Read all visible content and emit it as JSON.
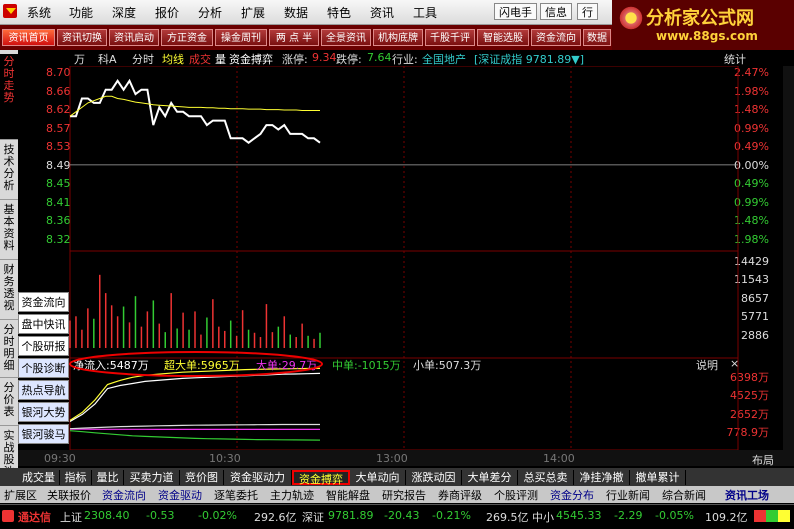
{
  "menu": {
    "items": [
      "系统",
      "功能",
      "深度",
      "报价",
      "分析",
      "扩展",
      "数据",
      "特色",
      "资讯",
      "工具"
    ],
    "right_buttons": [
      "闪电手",
      "信息",
      "行"
    ]
  },
  "logo": {
    "title": "分析家公式网",
    "url": "www.88gs.com"
  },
  "toolbar": {
    "buttons": [
      "资讯首页",
      "资讯切换",
      "资讯启动",
      "方正资金",
      "操金周刊",
      "两 点 半",
      "全景资讯",
      "机构底牌",
      "千股千评",
      "智能选股",
      "资金流向",
      "数据"
    ],
    "active": 0
  },
  "leftbar": {
    "items": [
      "分时走势",
      "技术分析",
      "基本资料",
      "财务透视",
      "分时明细",
      "分价表",
      "实战股池"
    ],
    "active": 0
  },
  "float_panel": [
    "资金流向",
    "盘中快讯",
    "个股研报",
    "个股诊断",
    "热点导航",
    "银河大势",
    "银河骏马"
  ],
  "header": {
    "wan": "万",
    "ke": "科A",
    "fenshi": "分时",
    "junxian": "均线",
    "chengjiao_a": "成交",
    "chengjiao_b": "量",
    "zjby": "资金搏弈",
    "zhangting_label": "涨停:",
    "zhangting": "9.34",
    "dieting_label": "跌停:",
    "dieting": "7.64",
    "hangye_label": "行业:",
    "hangye": "全国地产",
    "index": "[深证成指 9781.89▼]",
    "tongji": "统计"
  },
  "price_axis": {
    "left": [
      "8.70",
      "8.66",
      "8.62",
      "8.57",
      "8.53",
      "8.49",
      "8.45",
      "8.41",
      "8.36",
      "8.32"
    ],
    "right": [
      "2.47%",
      "1.98%",
      "1.48%",
      "0.99%",
      "0.49%",
      "0.00%",
      "0.49%",
      "0.99%",
      "1.48%",
      "1.98%"
    ]
  },
  "volume_axis": {
    "right": [
      "14429",
      "11543",
      "8657",
      "5771",
      "2886"
    ]
  },
  "flow_bar": {
    "net": "净流入:5487万",
    "super": "超大单:5965万",
    "big": "大单:29.7万",
    "mid": "中单:-1015万",
    "small": "小单:507.3万",
    "explain": "说明",
    "close": "×"
  },
  "flow_axis": {
    "right": [
      "6398万",
      "4525万",
      "2652万",
      "778.9万"
    ]
  },
  "time_axis": {
    "labels": [
      "09:30",
      "10:30",
      "13:00",
      "14:00"
    ],
    "layout": "布局"
  },
  "tabs": {
    "items": [
      "成交量",
      "指标",
      "量比",
      "买卖力道",
      "竞价图",
      "资金驱动力",
      "资金搏弈",
      "大单动向",
      "涨跌动因",
      "大单差分",
      "总买总卖",
      "净挂净撤",
      "撤单累计"
    ],
    "active": 6
  },
  "tabs2": {
    "items": [
      "扩展区",
      "关联报价",
      "资金流向",
      "资金驱动",
      "逐笔委托",
      "主力轨迹",
      "智能解盘",
      "研究报告",
      "券商评级",
      "个股评测",
      "资金分布",
      "行业新闻",
      "综合新闻"
    ],
    "selected": [
      2,
      3,
      10
    ],
    "right": "资讯工场"
  },
  "status": {
    "brand": "通达信",
    "sh_label": "上证",
    "sh": "2308.40",
    "sh_chg": "-0.53",
    "sh_pct": "-0.02%",
    "sh_amt": "292.6亿",
    "sz_label": "深证",
    "sz": "9781.89",
    "sz_chg": "-20.43",
    "sz_pct": "-0.21%",
    "sz_amt": "269.5亿",
    "zx_label": "中小",
    "zx": "4545.33",
    "zx_chg": "-2.29",
    "zx_pct": "-0.05%",
    "zx_amt": "109.2亿"
  },
  "chart_data": {
    "type": "line",
    "x_ticks": [
      "09:30",
      "10:30",
      "13:00",
      "14:00"
    ],
    "price": [
      8.6,
      8.6,
      8.64,
      8.64,
      8.63,
      8.63,
      8.66,
      8.66,
      8.68,
      8.66,
      8.68,
      8.65,
      8.66,
      8.66,
      8.58,
      8.62,
      8.6,
      8.63,
      8.61,
      8.61,
      8.6,
      8.6,
      8.6,
      8.58,
      8.59,
      8.59,
      8.59,
      8.55,
      8.55,
      8.55,
      8.54,
      8.55,
      8.56,
      8.58,
      8.58,
      8.57,
      8.58,
      8.56,
      8.56,
      8.56,
      8.55,
      8.55,
      8.54
    ],
    "avg": [
      8.6,
      8.61,
      8.62,
      8.63,
      8.635,
      8.64,
      8.645,
      8.645,
      8.64,
      8.638,
      8.635,
      8.632,
      8.63,
      8.628,
      8.626,
      8.625,
      8.624,
      8.623,
      8.622,
      8.621,
      8.62,
      8.62,
      8.62,
      8.619,
      8.619,
      8.618,
      8.618,
      8.617,
      8.617,
      8.617,
      8.616,
      8.616,
      8.616,
      8.615,
      8.615,
      8.615,
      8.614,
      8.614,
      8.614,
      8.613,
      8.613,
      8.613,
      8.613
    ],
    "ylim": [
      8.32,
      8.7
    ],
    "volume": [
      4500,
      5200,
      3000,
      6500,
      4800,
      12000,
      9000,
      7000,
      5200,
      6800,
      4200,
      8500,
      3500,
      6000,
      7800,
      4000,
      2600,
      9000,
      3200,
      5800,
      3000,
      6000,
      2200,
      5000,
      8000,
      3500,
      2800,
      4500,
      2000,
      6200,
      3000,
      2500,
      1800,
      7200,
      2600,
      3500,
      5200,
      2200,
      1800,
      4000,
      2000,
      1500,
      2500
    ],
    "volume_ylim": [
      0,
      14429
    ],
    "flow": {
      "net": [
        800,
        1500,
        2500,
        4000,
        4300,
        4500,
        4700,
        4800,
        4900,
        5000,
        5050,
        5100,
        5150,
        5200,
        5250,
        5300,
        5350,
        5400,
        5420,
        5450,
        5487
      ],
      "super": [
        900,
        1700,
        2900,
        4400,
        4800,
        5100,
        5300,
        5400,
        5500,
        5600,
        5650,
        5700,
        5750,
        5800,
        5850,
        5880,
        5900,
        5920,
        5940,
        5955,
        5965
      ],
      "big": [
        50,
        45,
        40,
        35,
        38,
        40,
        35,
        32,
        30,
        31,
        30,
        30,
        29.7,
        30,
        30,
        29.5,
        29.8,
        30,
        29.7,
        29.7,
        29.7
      ],
      "mid": [
        -100,
        -200,
        -300,
        -400,
        -500,
        -600,
        -650,
        -700,
        -750,
        -800,
        -850,
        -880,
        -900,
        -920,
        -950,
        -970,
        -980,
        -990,
        -1000,
        -1010,
        -1015
      ],
      "small": [
        100,
        150,
        200,
        250,
        300,
        320,
        350,
        380,
        400,
        420,
        440,
        450,
        460,
        470,
        480,
        490,
        495,
        500,
        503,
        505,
        507.3
      ],
      "ylim": [
        -1200,
        6398
      ]
    }
  }
}
